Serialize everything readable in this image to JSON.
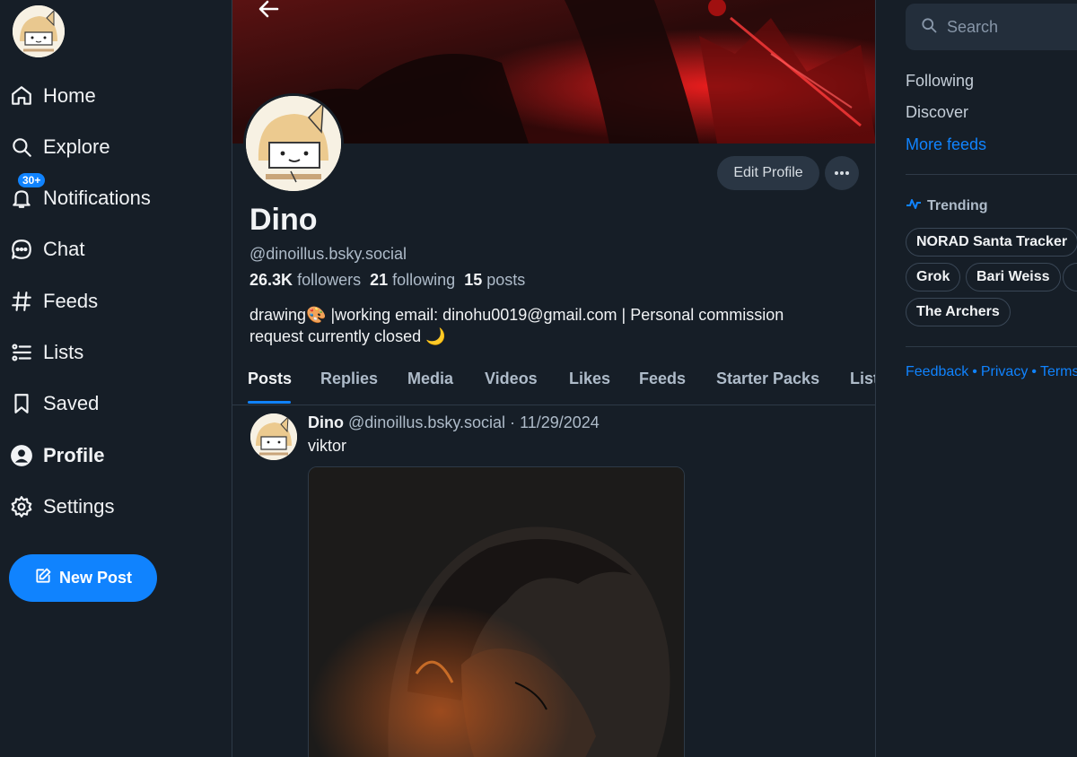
{
  "nav": {
    "items": [
      {
        "label": "Home",
        "icon": "home-icon"
      },
      {
        "label": "Explore",
        "icon": "search-icon"
      },
      {
        "label": "Notifications",
        "icon": "bell-icon",
        "badge": "30+"
      },
      {
        "label": "Chat",
        "icon": "chat-icon"
      },
      {
        "label": "Feeds",
        "icon": "hash-icon"
      },
      {
        "label": "Lists",
        "icon": "list-icon"
      },
      {
        "label": "Saved",
        "icon": "bookmark-icon"
      },
      {
        "label": "Profile",
        "icon": "user-icon"
      },
      {
        "label": "Settings",
        "icon": "gear-icon"
      }
    ],
    "active": "Profile",
    "new_post_label": "New Post"
  },
  "profile": {
    "display_name": "Dino",
    "handle": "@dinoillus.bsky.social",
    "followers_count": "26.3K",
    "followers_label": "followers",
    "following_count": "21",
    "following_label": "following",
    "posts_count": "15",
    "posts_label": "posts",
    "bio_line1": "drawing🎨  |working email: dinohu0019@gmail.com | Personal commission",
    "bio_line2": "request currently closed 🌙",
    "edit_label": "Edit Profile"
  },
  "tabs": [
    "Posts",
    "Replies",
    "Media",
    "Videos",
    "Likes",
    "Feeds",
    "Starter Packs",
    "List"
  ],
  "active_tab": "Posts",
  "post": {
    "author": "Dino",
    "handle": "@dinoillus.bsky.social",
    "separator": "·",
    "date": "11/29/2024",
    "text": "viktor"
  },
  "right": {
    "search_placeholder": "Search",
    "feeds": [
      "Following",
      "Discover"
    ],
    "more_feeds": "More feeds",
    "trending_title": "Trending",
    "trending": [
      "NORAD Santa Tracker",
      "Grok",
      "Bari Weiss",
      "The Archers"
    ],
    "footer": [
      "Feedback",
      "Privacy",
      "Terms"
    ],
    "footer_sep": "•"
  },
  "colors": {
    "background": "#161e27",
    "accent": "#1083fe",
    "muted_text": "#aebbc9",
    "border": "#2e3a47"
  }
}
